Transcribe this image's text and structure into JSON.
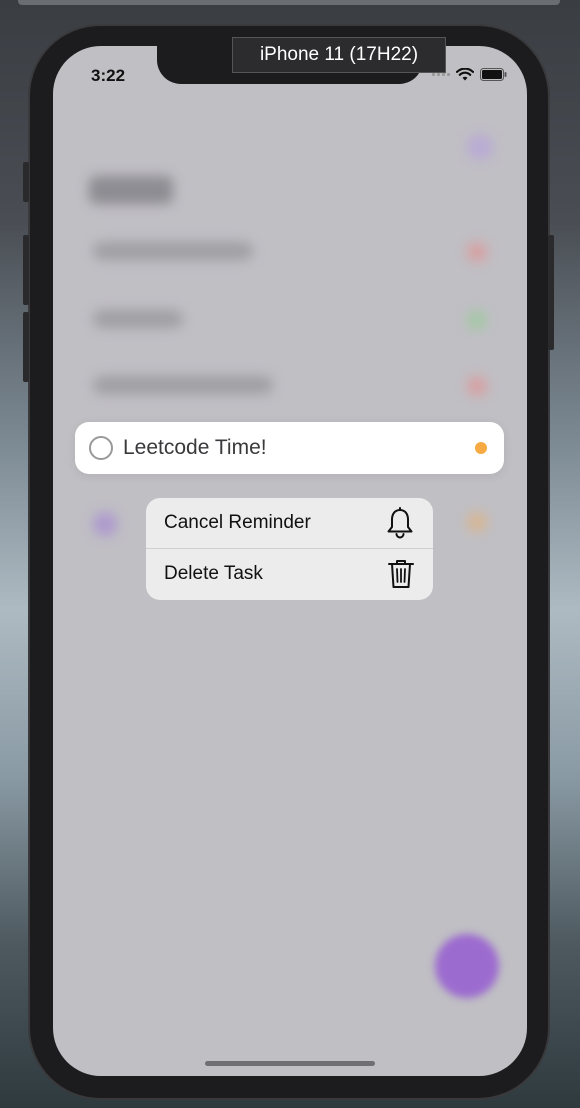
{
  "simulator": {
    "label": "iPhone 11 (17H22)"
  },
  "status_bar": {
    "time": "3:22"
  },
  "task": {
    "title": "Leetcode Time!",
    "flag_color": "#f7a942"
  },
  "context_menu": {
    "items": [
      {
        "label": "Cancel Reminder",
        "icon": "bell-icon"
      },
      {
        "label": "Delete Task",
        "icon": "trash-icon"
      }
    ]
  },
  "colors": {
    "accent": "#9c6bcf"
  }
}
